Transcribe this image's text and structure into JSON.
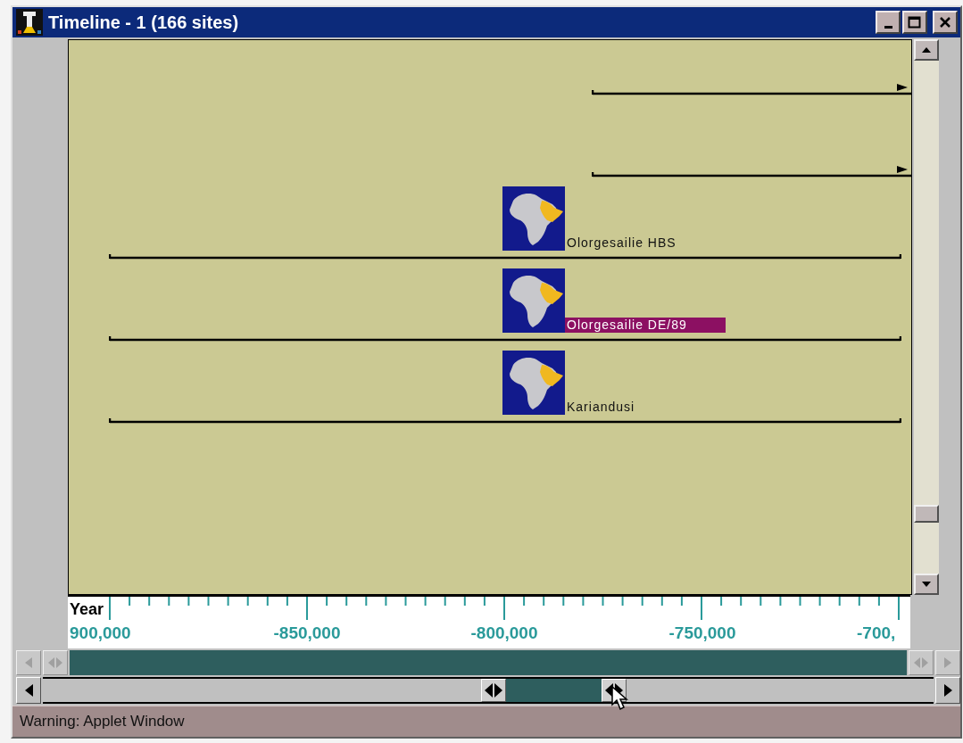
{
  "window": {
    "title": "Timeline - 1 (166 sites)"
  },
  "timeline": {
    "rows": [
      {
        "kind": "continues"
      },
      {
        "kind": "continues"
      },
      {
        "kind": "span",
        "label": "Olorgesailie HBS",
        "selected": false
      },
      {
        "kind": "span",
        "label": "Olorgesailie DE/89",
        "selected": true
      },
      {
        "kind": "span",
        "label": "Kariandusi",
        "selected": false
      }
    ]
  },
  "axis": {
    "title": "Year",
    "ticks": [
      {
        "label": "900,000",
        "kind": "left"
      },
      {
        "label": "-850,000",
        "kind": "center"
      },
      {
        "label": "-800,000",
        "kind": "center"
      },
      {
        "label": "-750,000",
        "kind": "center"
      },
      {
        "label": "-700,",
        "kind": "left"
      }
    ]
  },
  "status_bar": "Warning: Applet Window"
}
